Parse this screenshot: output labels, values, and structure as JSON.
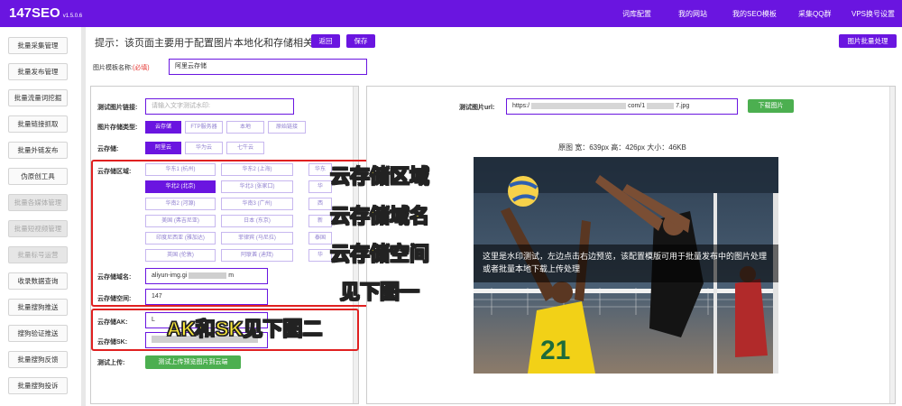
{
  "app": {
    "brand": "147SEO",
    "version": "v1.5.0.6"
  },
  "topnav": [
    "词库配置",
    "我的网站",
    "我的SEO模板",
    "采集QQ群",
    "VPS换号设置"
  ],
  "sidebar": [
    "批量采集管理",
    "批量发布管理",
    "批量流量词挖掘",
    "批量链接抓取",
    "批量外链发布",
    "伪原创工具",
    "批量各媒体管理",
    "批量短视频管理",
    "批量标号运营",
    "收录数据查询",
    "批量搜狗推送",
    "搜狗验证推送",
    "批量搜狗反馈",
    "批量搜狗投诉"
  ],
  "header": {
    "hint": "提示：该页面主要用于配置图片本地化和存储相关",
    "back": "返回",
    "save": "保存",
    "batch": "图片批量处理"
  },
  "template": {
    "label": "图片模板名称:",
    "required": "(必填)",
    "value": "阿里云存储"
  },
  "left": {
    "test_link_label": "测试图片链接:",
    "test_link_placeholder": "请输入文字测试水印:",
    "storage_type_label": "图片存储类型:",
    "storage_types": [
      "云存储",
      "FTP服务器",
      "本地",
      "原始链接"
    ],
    "cloud_label": "云存储:",
    "clouds": [
      "阿里云",
      "华为云",
      "七牛云"
    ],
    "region_label": "云存储区域:",
    "regions": [
      [
        "华东1 (杭州)",
        "华东2 (上海)",
        "华东"
      ],
      [
        "华北2 (北京)",
        "华北3 (张家口)",
        "华"
      ],
      [
        "华南2 (河源)",
        "华南3 (广州)",
        "西"
      ],
      [
        "美国 (弗吉尼亚)",
        "日本 (东京)",
        "新"
      ],
      [
        "印度尼西亚 (雅加达)",
        "菲律宾 (马尼拉)",
        "泰国"
      ],
      [
        "英国 (伦敦)",
        "阿联酋 (迪拜)",
        "华"
      ]
    ],
    "domain_label": "云存储域名:",
    "domain_value": "aliyun-img.gi",
    "domain_tail": "m",
    "space_label": "云存储空间:",
    "space_value": "147",
    "ak_label": "云存储AK:",
    "ak_value": "L",
    "sk_label": "云存储SK:",
    "upload_label": "测试上传:",
    "upload_btn": "测试上传预览图片到云端"
  },
  "right": {
    "url_label": "测试图片url:",
    "url_prefix": "https:/",
    "url_mid": "com/1",
    "url_suffix": "7.jpg",
    "download_btn": "下载图片",
    "info": "原图  宽：639px 高：426px 大小：46KB",
    "watermark": "这里是水印测试，左边点击右边预览，该配置模版可用于批量发布中的图片处理或者批量本地下载上传处理"
  },
  "annotations": {
    "a1": "云存储区域",
    "a2": "云存储域名",
    "a3": "云存储空间",
    "a4": "见下图一",
    "a5": "AK和SK见下图二"
  },
  "colors": {
    "primary": "#6a15e0",
    "green": "#4caf50",
    "annotation": "#ffeb3b",
    "redbox": "#e02020"
  }
}
